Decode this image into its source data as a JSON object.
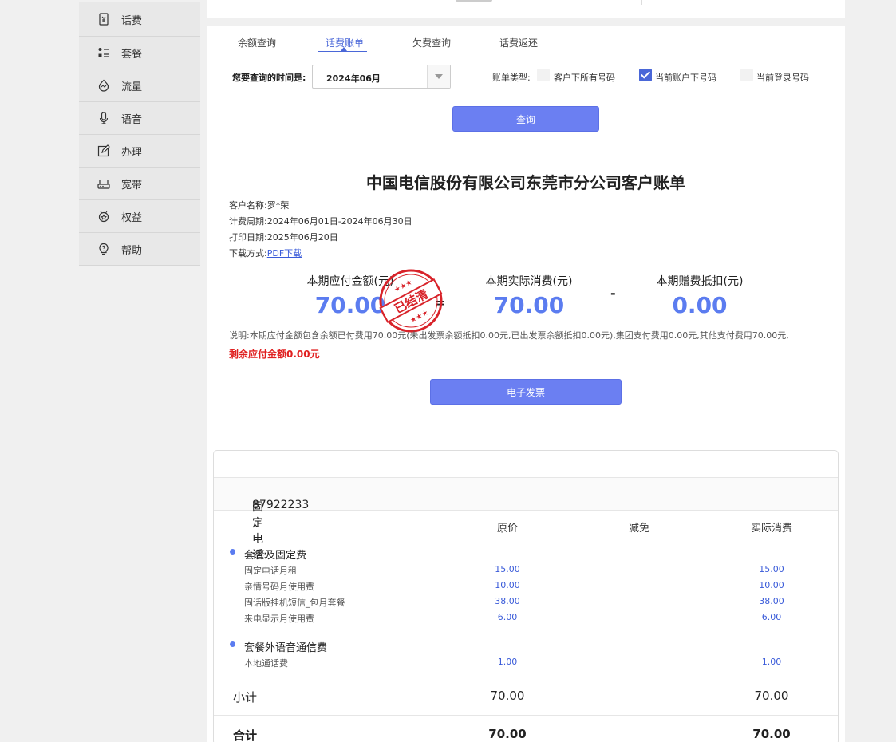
{
  "sidebar": {
    "items": [
      {
        "label": "话费",
        "icon": "yuan-card-icon"
      },
      {
        "label": "套餐",
        "icon": "list-icon"
      },
      {
        "label": "流量",
        "icon": "flow-icon"
      },
      {
        "label": "语音",
        "icon": "microphone-icon"
      },
      {
        "label": "办理",
        "icon": "edit-icon"
      },
      {
        "label": "宽带",
        "icon": "router-icon"
      },
      {
        "label": "权益",
        "icon": "badge-icon"
      },
      {
        "label": "帮助",
        "icon": "help-bulb-icon"
      }
    ]
  },
  "tabs": [
    {
      "label": "余额查询",
      "active": false
    },
    {
      "label": "话费账单",
      "active": true
    },
    {
      "label": "欠费查询",
      "active": false
    },
    {
      "label": "话费返还",
      "active": false
    }
  ],
  "query": {
    "time_label": "您要查询的时间是:",
    "time_value": "2024年06月",
    "bill_type_label": "账单类型:",
    "options": [
      {
        "label": "客户下所有号码",
        "checked": false
      },
      {
        "label": "当前账户下号码",
        "checked": true
      },
      {
        "label": "当前登录号码",
        "checked": false
      }
    ],
    "query_button": "查询"
  },
  "bill": {
    "title": "中国电信股份有限公司东莞市分公司客户账单",
    "customer_label": "客户名称:",
    "customer_value": "罗*荣",
    "period_label": "计费周期:",
    "period_value": "2024年06月01日-2024年06月30日",
    "print_label": "打印日期:",
    "print_value": "2025年06月20日",
    "download_label": "下载方式:",
    "download_link": "PDF下载",
    "summary": [
      {
        "label": "本期应付金额(元)",
        "value": "70.00"
      },
      {
        "label": "本期实际消费(元)",
        "value": "70.00"
      },
      {
        "label": "本期赠费抵扣(元)",
        "value": "0.00"
      }
    ],
    "op_equals": "=",
    "op_minus": "-",
    "stamp_text": "已结清",
    "note": "说明:本期应付金额包含余额已付费用70.00元(未出发票余额抵扣0.00元,已出发票余额抵扣0.00元),集团支付费用0.00元,其他支付费用70.00元,",
    "remain": "剩余应付金额0.00元",
    "invoice_button": "电子发票"
  },
  "detail": {
    "phone_label": "固定电话:",
    "phone_number": "87922233",
    "columns": [
      "原价",
      "减免",
      "实际消费"
    ],
    "groups": [
      {
        "name": "套餐及固定费",
        "items": [
          {
            "name": "固定电话月租",
            "price": "15.00",
            "actual": "15.00"
          },
          {
            "name": "亲情号码月使用费",
            "price": "10.00",
            "actual": "10.00"
          },
          {
            "name": "固话版挂机短信_包月套餐",
            "price": "38.00",
            "actual": "38.00"
          },
          {
            "name": "来电显示月使用费",
            "price": "6.00",
            "actual": "6.00"
          }
        ]
      },
      {
        "name": "套餐外语音通信费",
        "items": [
          {
            "name": "本地通话费",
            "price": "1.00",
            "actual": "1.00"
          }
        ]
      }
    ],
    "subtotal": {
      "label": "小计",
      "price": "70.00",
      "actual": "70.00"
    },
    "total": {
      "label": "合计",
      "price": "70.00",
      "actual": "70.00"
    }
  },
  "colors": {
    "accent": "#4a67d8",
    "button": "#6b7ff2",
    "value_blue": "#5b7cf0",
    "warning_red": "#e02020",
    "stamp_red": "#d8232a"
  }
}
